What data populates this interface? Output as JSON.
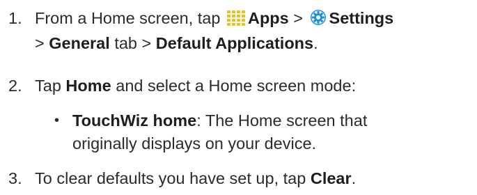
{
  "step1": {
    "number": "1.",
    "prefix": "From a Home screen, tap",
    "apps": "Apps",
    "sep1": ">",
    "settings": "Settings",
    "sep2": ">",
    "general": "General",
    "tab": "tab",
    "sep3": ">",
    "default_apps": "Default Applications",
    "end": ".",
    "icons": [
      "apps-grid-icon",
      "settings-gear-icon"
    ]
  },
  "step2": {
    "number": "2.",
    "tap": "Tap",
    "home": "Home",
    "rest": "and select a Home screen mode:"
  },
  "bullet": {
    "glyph": "•",
    "term": "TouchWiz home",
    "colon": ":",
    "line1": "The Home screen that",
    "line2": "originally displays on your device."
  },
  "step3": {
    "number": "3.",
    "text": "To clear defaults you have set up, tap",
    "clear": "Clear",
    "end": "."
  },
  "colors": {
    "text": "#2b2b2b",
    "apps_icon": "#e8c21a",
    "settings_icon": "#1f8fd6"
  }
}
